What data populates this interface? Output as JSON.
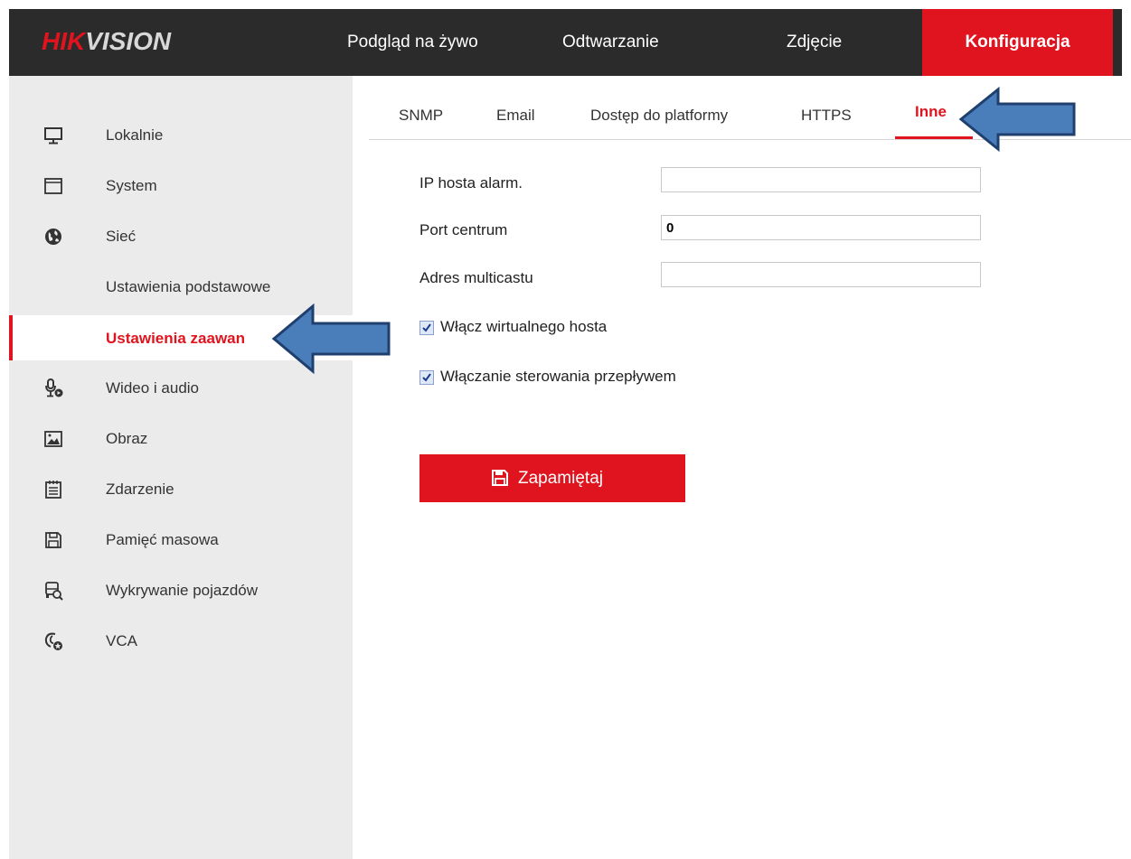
{
  "header": {
    "logo_hik": "HIK",
    "logo_vision": "VISION",
    "nav": [
      {
        "label": "Podgląd na żywo"
      },
      {
        "label": "Odtwarzanie"
      },
      {
        "label": "Zdjęcie"
      },
      {
        "label": "Konfiguracja",
        "active": true
      }
    ]
  },
  "sidebar": {
    "items": [
      {
        "label": "Lokalnie",
        "icon": "monitor-icon"
      },
      {
        "label": "System",
        "icon": "window-icon"
      },
      {
        "label": "Sieć",
        "icon": "globe-icon"
      },
      {
        "label": "Ustawienia podstawowe"
      },
      {
        "label": "Ustawienia zaawan",
        "active": true
      },
      {
        "label": "Wideo i audio",
        "icon": "microphone-icon"
      },
      {
        "label": "Obraz",
        "icon": "image-icon"
      },
      {
        "label": "Zdarzenie",
        "icon": "calendar-icon"
      },
      {
        "label": "Pamięć masowa",
        "icon": "save-disk-icon"
      },
      {
        "label": "Wykrywanie pojazdów",
        "icon": "vehicle-search-icon"
      },
      {
        "label": "VCA",
        "icon": "vca-icon"
      }
    ]
  },
  "tabs": [
    {
      "label": "SNMP"
    },
    {
      "label": "Email"
    },
    {
      "label": "Dostęp do platformy"
    },
    {
      "label": "HTTPS"
    },
    {
      "label": "Inne",
      "active": true
    }
  ],
  "form": {
    "alarm_host_ip": {
      "label": "IP hosta alarm.",
      "value": ""
    },
    "center_port": {
      "label": "Port centrum",
      "value": "0"
    },
    "multicast_address": {
      "label": "Adres multicastu",
      "value": ""
    },
    "virtual_host": {
      "label": "Włącz wirtualnego hosta",
      "checked": true
    },
    "flow_control": {
      "label": "Włączanie sterowania przepływem",
      "checked": true
    }
  },
  "save_button": {
    "label": "Zapamiętaj"
  },
  "colors": {
    "accent": "#e0141e",
    "header_bg": "#2b2b2b",
    "sidebar_bg": "#ebebeb",
    "arrow_fill": "#4a7ebb",
    "arrow_stroke": "#1f3f6e"
  }
}
